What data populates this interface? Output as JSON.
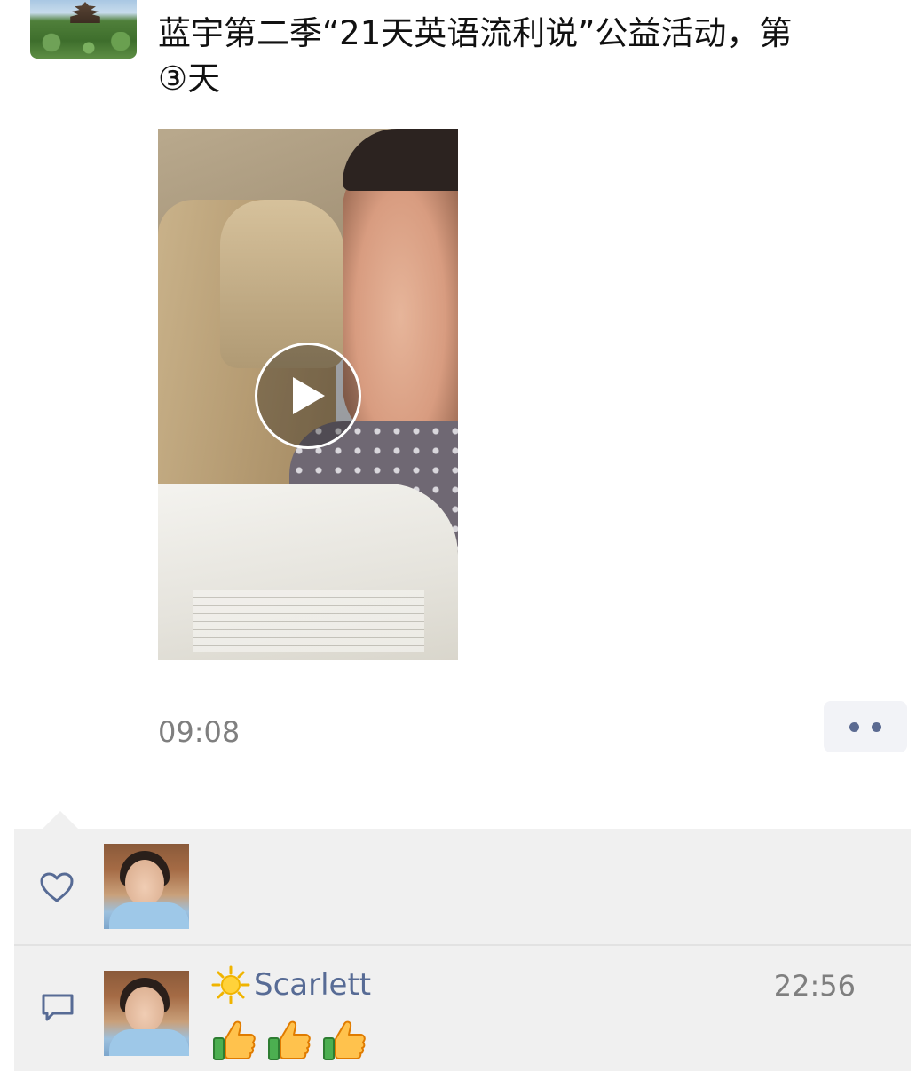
{
  "post": {
    "text": "蓝宇第二季“21天英语流利说”公益活动，第\n③天",
    "timestamp": "09:08"
  },
  "comments": [
    {
      "name": "Scarlett",
      "time": "22:56",
      "emoji_icons": [
        "thumbs-up-icon",
        "thumbs-up-icon",
        "thumbs-up-icon"
      ]
    }
  ],
  "icons": {
    "like": "heart-icon",
    "comment": "comment-icon",
    "more": "more-dots-icon",
    "play": "play-icon",
    "name_prefix": "sun-icon"
  },
  "colors": {
    "link_name": "#576b95",
    "timestamp": "#7f7f7f",
    "panel_bg": "#f0f0f0",
    "more_dots": "#5b6a91"
  }
}
